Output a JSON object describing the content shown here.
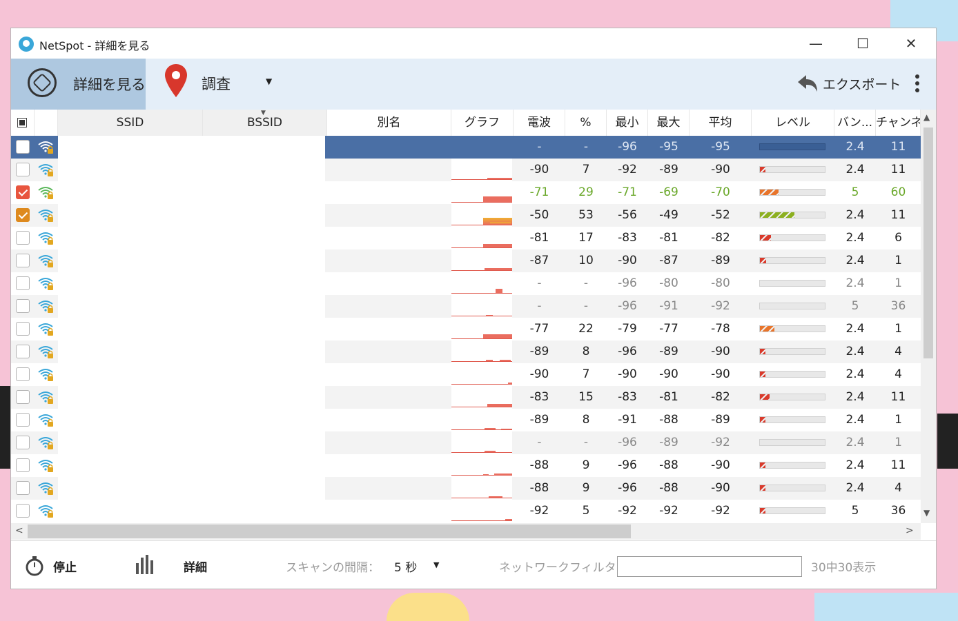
{
  "window": {
    "title": "NetSpot - 詳細を見る"
  },
  "toolbar": {
    "details_label": "詳細を見る",
    "survey_label": "調査",
    "export_label": "エクスポート"
  },
  "columns": {
    "ssid": "SSID",
    "bssid": "BSSID",
    "alias": "別名",
    "graph": "グラフ",
    "signal": "電波",
    "percent": "%",
    "min": "最小",
    "max": "最大",
    "avg": "平均",
    "level": "レベル",
    "band": "バン...",
    "channel": "チャンネ"
  },
  "rows": [
    {
      "checked": "none",
      "signal": "-",
      "percent": "-",
      "min": "-96",
      "max": "-95",
      "avg": "-95",
      "band": "2.4",
      "channel": "11",
      "level": 0,
      "style": "sel"
    },
    {
      "checked": "none",
      "signal": "-90",
      "percent": "7",
      "min": "-92",
      "max": "-89",
      "avg": "-90",
      "band": "2.4",
      "channel": "11",
      "level": 7,
      "style": "alt"
    },
    {
      "checked": "red",
      "signal": "-71",
      "percent": "29",
      "min": "-71",
      "max": "-69",
      "avg": "-70",
      "band": "5",
      "channel": "60",
      "level": 29,
      "style": "green"
    },
    {
      "checked": "orange",
      "signal": "-50",
      "percent": "53",
      "min": "-56",
      "max": "-49",
      "avg": "-52",
      "band": "2.4",
      "channel": "11",
      "level": 53,
      "style": "alt"
    },
    {
      "checked": "none",
      "signal": "-81",
      "percent": "17",
      "min": "-83",
      "max": "-81",
      "avg": "-82",
      "band": "2.4",
      "channel": "6",
      "level": 17,
      "style": ""
    },
    {
      "checked": "none",
      "signal": "-87",
      "percent": "10",
      "min": "-90",
      "max": "-87",
      "avg": "-89",
      "band": "2.4",
      "channel": "1",
      "level": 10,
      "style": "alt"
    },
    {
      "checked": "none",
      "signal": "-",
      "percent": "-",
      "min": "-96",
      "max": "-80",
      "avg": "-80",
      "band": "2.4",
      "channel": "1",
      "level": 0,
      "style": "dim"
    },
    {
      "checked": "none",
      "signal": "-",
      "percent": "-",
      "min": "-96",
      "max": "-91",
      "avg": "-92",
      "band": "5",
      "channel": "36",
      "level": 0,
      "style": "dim alt"
    },
    {
      "checked": "none",
      "signal": "-77",
      "percent": "22",
      "min": "-79",
      "max": "-77",
      "avg": "-78",
      "band": "2.4",
      "channel": "1",
      "level": 22,
      "style": ""
    },
    {
      "checked": "none",
      "signal": "-89",
      "percent": "8",
      "min": "-96",
      "max": "-89",
      "avg": "-90",
      "band": "2.4",
      "channel": "4",
      "level": 8,
      "style": "alt"
    },
    {
      "checked": "none",
      "signal": "-90",
      "percent": "7",
      "min": "-90",
      "max": "-90",
      "avg": "-90",
      "band": "2.4",
      "channel": "4",
      "level": 7,
      "style": ""
    },
    {
      "checked": "none",
      "signal": "-83",
      "percent": "15",
      "min": "-83",
      "max": "-81",
      "avg": "-82",
      "band": "2.4",
      "channel": "11",
      "level": 15,
      "style": "alt"
    },
    {
      "checked": "none",
      "signal": "-89",
      "percent": "8",
      "min": "-91",
      "max": "-88",
      "avg": "-89",
      "band": "2.4",
      "channel": "1",
      "level": 8,
      "style": ""
    },
    {
      "checked": "none",
      "signal": "-",
      "percent": "-",
      "min": "-96",
      "max": "-89",
      "avg": "-92",
      "band": "2.4",
      "channel": "1",
      "level": 0,
      "style": "dim alt"
    },
    {
      "checked": "none",
      "signal": "-88",
      "percent": "9",
      "min": "-96",
      "max": "-88",
      "avg": "-90",
      "band": "2.4",
      "channel": "11",
      "level": 9,
      "style": ""
    },
    {
      "checked": "none",
      "signal": "-88",
      "percent": "9",
      "min": "-96",
      "max": "-88",
      "avg": "-90",
      "band": "2.4",
      "channel": "4",
      "level": 9,
      "style": "alt"
    },
    {
      "checked": "none",
      "signal": "-92",
      "percent": "5",
      "min": "-92",
      "max": "-92",
      "avg": "-92",
      "band": "5",
      "channel": "36",
      "level": 5,
      "style": ""
    }
  ],
  "footer": {
    "stop_label": "停止",
    "detail_label": "詳細",
    "interval_label": "スキャンの間隔：",
    "interval_value": "5 秒",
    "filter_label": "ネットワークフィルタ：",
    "filter_value": "",
    "count_label": "30中30表示"
  },
  "colors": {
    "selected_row": "#4a6fa5",
    "toolbar_bg": "#e4eef8",
    "level_red": "#d93a2b",
    "level_orange": "#e8742a",
    "level_green": "#8cb020"
  }
}
